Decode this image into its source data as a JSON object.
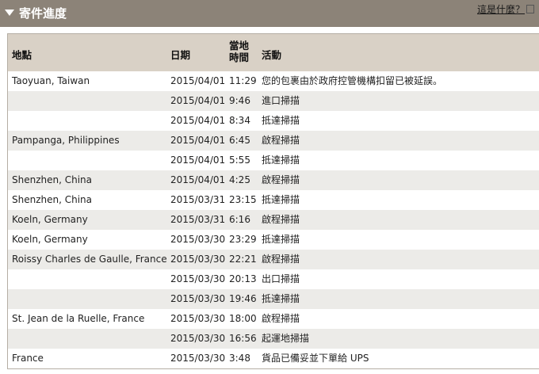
{
  "header": {
    "title": "寄件進度",
    "help_link": "這是什麼？"
  },
  "table": {
    "columns": {
      "location": "地點",
      "date": "日期",
      "time_line1": "當地",
      "time_line2": "時間",
      "activity": "活動"
    },
    "rows": [
      {
        "location": "Taoyuan, Taiwan",
        "date": "2015/04/01",
        "time": "11:29",
        "activity": "您的包裹由於政府控管機構扣留已被延誤。"
      },
      {
        "location": "",
        "date": "2015/04/01",
        "time": "9:46",
        "activity": "進口掃描"
      },
      {
        "location": "",
        "date": "2015/04/01",
        "time": "8:34",
        "activity": "抵達掃描"
      },
      {
        "location": "Pampanga, Philippines",
        "date": "2015/04/01",
        "time": "6:45",
        "activity": "啟程掃描"
      },
      {
        "location": "",
        "date": "2015/04/01",
        "time": "5:55",
        "activity": "抵達掃描"
      },
      {
        "location": "Shenzhen, China",
        "date": "2015/04/01",
        "time": "4:25",
        "activity": "啟程掃描"
      },
      {
        "location": "Shenzhen, China",
        "date": "2015/03/31",
        "time": "23:15",
        "activity": "抵達掃描"
      },
      {
        "location": "Koeln, Germany",
        "date": "2015/03/31",
        "time": "6:16",
        "activity": "啟程掃描"
      },
      {
        "location": "Koeln, Germany",
        "date": "2015/03/30",
        "time": "23:29",
        "activity": "抵達掃描"
      },
      {
        "location": "Roissy Charles de Gaulle, France",
        "date": "2015/03/30",
        "time": "22:21",
        "activity": "啟程掃描"
      },
      {
        "location": "",
        "date": "2015/03/30",
        "time": "20:13",
        "activity": "出口掃描"
      },
      {
        "location": "",
        "date": "2015/03/30",
        "time": "19:46",
        "activity": "抵達掃描"
      },
      {
        "location": "St. Jean de la Ruelle, France",
        "date": "2015/03/30",
        "time": "18:00",
        "activity": "啟程掃描"
      },
      {
        "location": "",
        "date": "2015/03/30",
        "time": "16:56",
        "activity": "起運地掃描"
      },
      {
        "location": "France",
        "date": "2015/03/30",
        "time": "3:48",
        "activity": "貨品已備妥並下單給 UPS"
      }
    ]
  }
}
